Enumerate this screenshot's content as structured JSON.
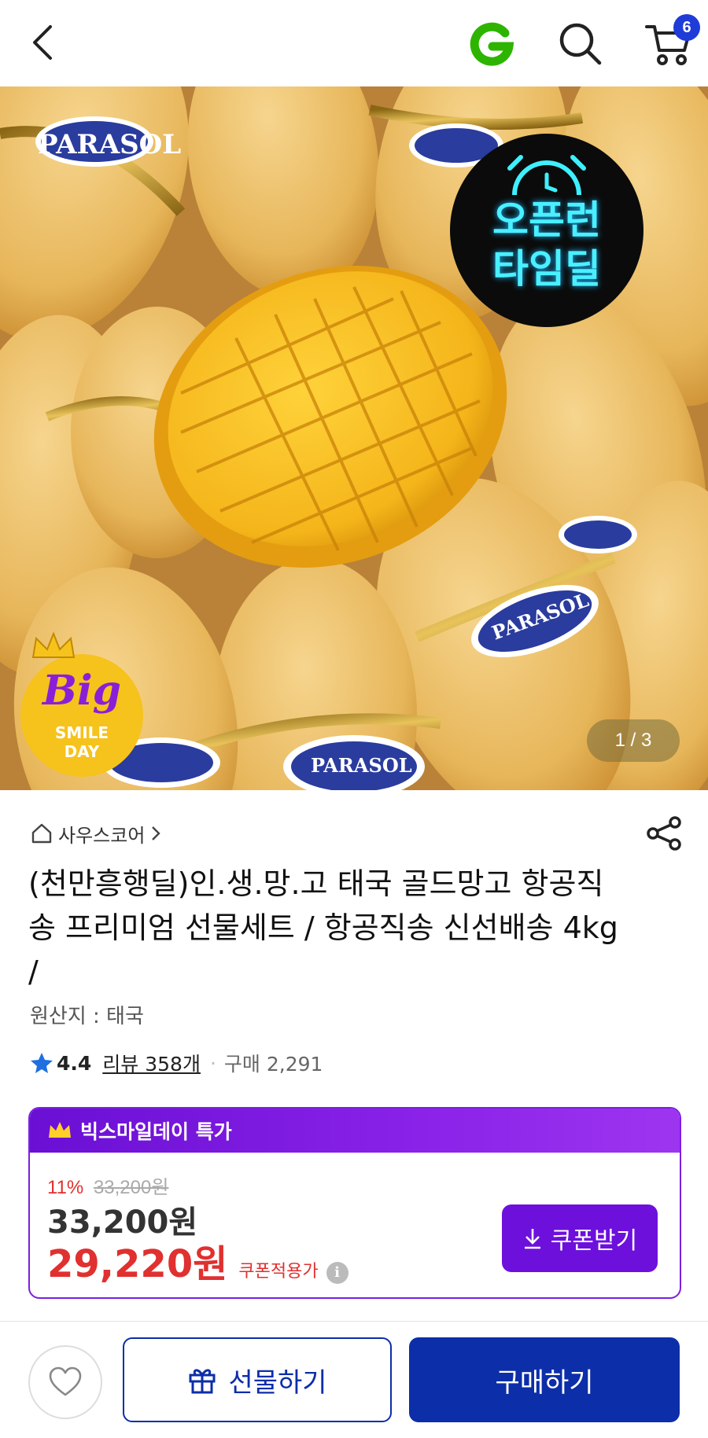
{
  "header": {
    "cart_count": "6",
    "icons": [
      "back-arrow-icon",
      "g-logo-icon",
      "search-icon",
      "cart-icon"
    ]
  },
  "hero": {
    "brand_text": "PARASOL",
    "badge_timedeal_line1": "오픈런",
    "badge_timedeal_line2": "타임딜",
    "bigsmile_big": "Big",
    "bigsmile_smile": "SMILE",
    "bigsmile_day": "DAY",
    "image_counter": "1 / 3"
  },
  "product": {
    "seller": "사우스코어",
    "title": "(천만흥행딜)인.생.망.고 태국 골드망고 항공직송 프리미엄 선물세트 / 항공직송 신선배송 4kg /",
    "origin": "원산지 : 태국",
    "rating": "4.4",
    "review_label": "리뷰 358개",
    "purchase_label": "구매 2,291"
  },
  "deal": {
    "header": "빅스마일데이 특가",
    "discount_pct": "11%",
    "original_price": "33,200원",
    "price": "33,200원",
    "coupon_price": "29,220원",
    "coupon_note": "쿠폰적용가",
    "coupon_button": "쿠폰받기",
    "colors": {
      "accent": "#6d10dc",
      "sale": "#e0302f"
    }
  },
  "bottom": {
    "gift_label": "선물하기",
    "buy_label": "구매하기",
    "colors": {
      "primary": "#0c2ea8"
    }
  }
}
